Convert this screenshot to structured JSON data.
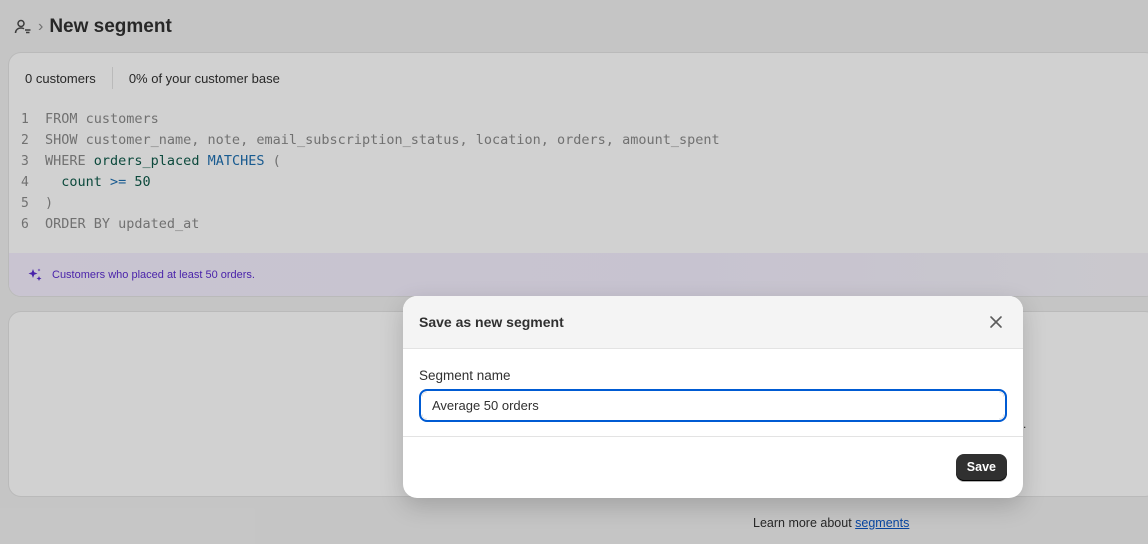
{
  "header": {
    "icon": "segment-icon",
    "separator": "›",
    "title": "New segment"
  },
  "stats": {
    "customers": "0 customers",
    "base": "0% of your customer base"
  },
  "query": {
    "lines": [
      {
        "n": "1",
        "parts": [
          {
            "t": "FROM customers",
            "c": "kw"
          }
        ]
      },
      {
        "n": "2",
        "parts": [
          {
            "t": "SHOW customer_name, note, email_subscription_status, location, orders, amount_spent",
            "c": "kw"
          }
        ]
      },
      {
        "n": "3",
        "parts": [
          {
            "t": "WHERE ",
            "c": "kw"
          },
          {
            "t": "orders_placed",
            "c": "id"
          },
          {
            "t": " MATCHES",
            "c": "op"
          },
          {
            "t": " (",
            "c": "plain"
          }
        ]
      },
      {
        "n": "4",
        "parts": [
          {
            "t": "  count",
            "c": "ind"
          },
          {
            "t": " >= ",
            "c": "op"
          },
          {
            "t": "50",
            "c": "num"
          }
        ]
      },
      {
        "n": "5",
        "parts": [
          {
            "t": ")",
            "c": "plain"
          }
        ]
      },
      {
        "n": "6",
        "parts": [
          {
            "t": "ORDER BY updated_at",
            "c": "kw"
          }
        ]
      }
    ]
  },
  "ai_summary": {
    "icon": "sparkle-icon",
    "text": "Customers who placed at least 50 orders."
  },
  "learn_more": {
    "prefix": "Learn more about ",
    "link": "segments"
  },
  "modal": {
    "title": "Save as new segment",
    "close_icon": "close-icon",
    "field_label": "Segment name",
    "field_value": "Average 50 orders",
    "save_label": "Save"
  },
  "colors": {
    "accent": "#005bd3",
    "primary_button": "#303030",
    "ai_text": "#5a2bd0"
  }
}
